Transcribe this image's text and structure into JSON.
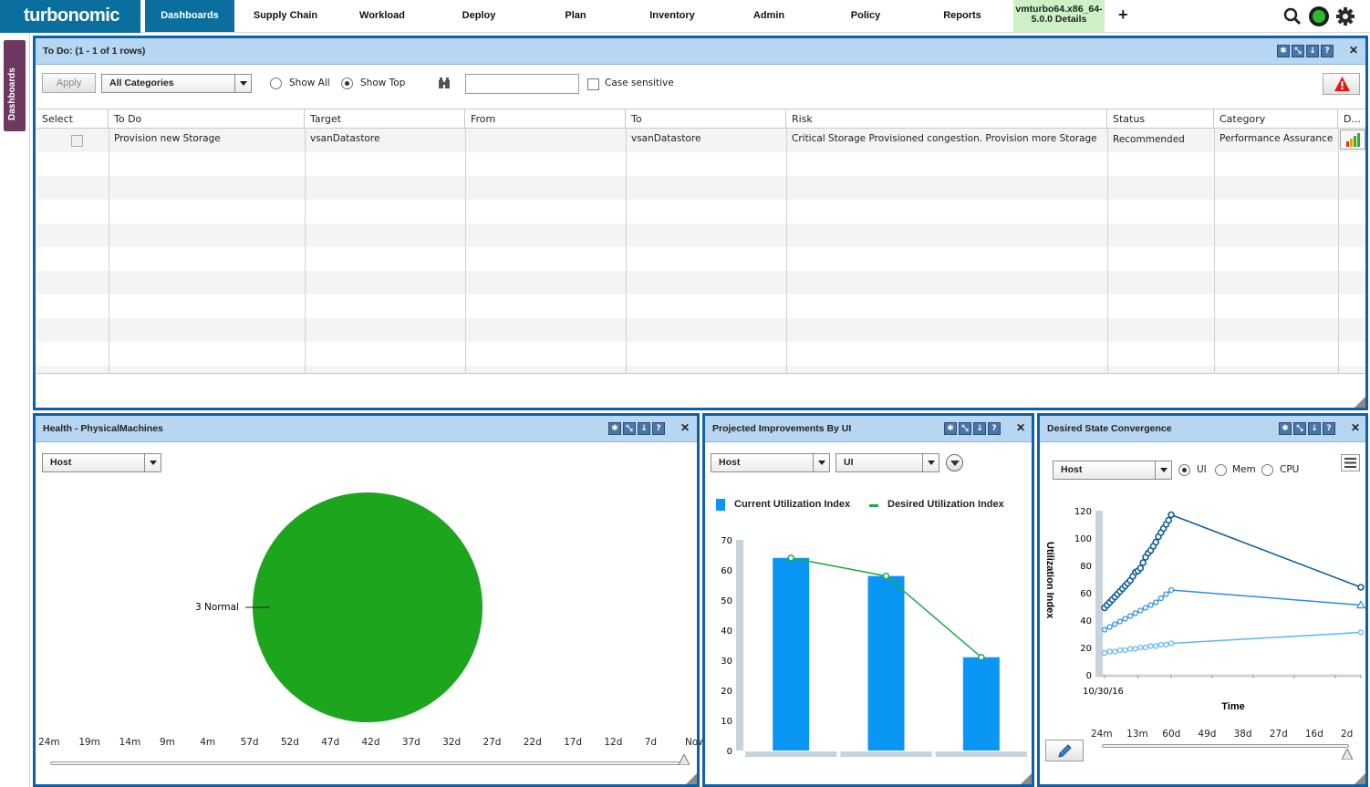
{
  "nav": {
    "logo": "turbonomic",
    "items": [
      {
        "label": "Dashboards",
        "active": true
      },
      {
        "label": "Supply Chain"
      },
      {
        "label": "Workload"
      },
      {
        "label": "Deploy"
      },
      {
        "label": "Plan"
      },
      {
        "label": "Inventory"
      },
      {
        "label": "Admin"
      },
      {
        "label": "Policy"
      },
      {
        "label": "Reports"
      }
    ],
    "vm_tab_line1": "vmturbo64.x86_64-",
    "vm_tab_line2": "5.0.0 Details",
    "add_label": "+"
  },
  "sidebar": {
    "tab_label": "Dashboards"
  },
  "todo": {
    "title": "To Do:",
    "rows_info": "(1 - 1 of 1 rows)",
    "apply_label": "Apply",
    "category_select": "All Categories",
    "show_all_label": "Show All",
    "show_top_label": "Show Top",
    "filter_value": "",
    "case_sensitive_label": "Case sensitive",
    "columns": [
      "Select",
      "To Do",
      "Target",
      "From",
      "To",
      "Risk",
      "Status",
      "Category",
      "D..."
    ],
    "row": {
      "todo": "Provision new Storage",
      "target": "vsanDatastore",
      "from": "",
      "to": "vsanDatastore",
      "risk": "Critical Storage Provisioned congestion. Provision more Storage",
      "status": "Recommended",
      "category": "Performance Assurance"
    }
  },
  "health": {
    "title": "Health - PhysicalMachines",
    "select": "Host",
    "slice_label": "3 Normal",
    "slice_color": "#1ea51e",
    "timeline": [
      "24m",
      "19m",
      "14m",
      "9m",
      "4m",
      "57d",
      "52d",
      "47d",
      "42d",
      "37d",
      "32d",
      "27d",
      "22d",
      "17d",
      "12d",
      "7d",
      "Now"
    ]
  },
  "projected": {
    "title": "Projected Improvements By UI",
    "select1": "Host",
    "select2": "UI",
    "legend_current": "Current Utilization Index",
    "legend_desired": "Desired Utilization Index",
    "current_color": "#0a96f5",
    "desired_color": "#1faa4a"
  },
  "desired": {
    "title": "Desired State Convergence",
    "select": "Host",
    "radio_ui": "UI",
    "radio_mem": "Mem",
    "radio_cpu": "CPU",
    "ylabel": "Utilization Index",
    "xlabel": "Time",
    "date_label": "10/30/16",
    "timeline": [
      "24m",
      "13m",
      "60d",
      "49d",
      "38d",
      "27d",
      "16d",
      "2d"
    ]
  },
  "chart_data": [
    {
      "type": "pie",
      "title": "Health - PhysicalMachines",
      "slices": [
        {
          "label": "Normal",
          "value": 3,
          "color": "#1ea51e"
        }
      ]
    },
    {
      "type": "bar",
      "title": "Projected Improvements By UI",
      "ylim": [
        0,
        70
      ],
      "yticks": [
        0,
        10,
        20,
        30,
        40,
        50,
        60,
        70
      ],
      "categories": [
        "",
        "",
        ""
      ],
      "series": [
        {
          "name": "Current Utilization Index",
          "type": "bar",
          "values": [
            64,
            58,
            31
          ]
        },
        {
          "name": "Desired Utilization Index",
          "type": "line",
          "values": [
            64,
            58,
            31
          ]
        }
      ]
    },
    {
      "type": "line",
      "title": "Desired State Convergence",
      "xlabel": "Time",
      "ylabel": "Utilization Index",
      "ylim": [
        0,
        120
      ],
      "yticks": [
        0,
        20,
        40,
        60,
        80,
        100,
        120
      ],
      "series": [
        {
          "name": "UI",
          "color": "#0d5c96",
          "x": [
            0.0,
            0.01,
            0.02,
            0.03,
            0.04,
            0.05,
            0.06,
            0.07,
            0.08,
            0.09,
            0.1,
            0.11,
            0.12,
            0.13,
            0.14,
            0.15,
            0.16,
            0.17,
            0.18,
            0.19,
            0.2,
            0.21,
            0.22,
            0.23,
            0.24,
            0.25,
            0.26,
            1.0
          ],
          "y": [
            49,
            51,
            53,
            55,
            57,
            59,
            61,
            63,
            65,
            67,
            69,
            72,
            75,
            76,
            78,
            82,
            86,
            89,
            91,
            94,
            97,
            101,
            104,
            107,
            110,
            113,
            117,
            64
          ]
        },
        {
          "name": "Mem",
          "color": "#2a8ee0",
          "x": [
            0.0,
            0.02,
            0.04,
            0.06,
            0.08,
            0.1,
            0.12,
            0.14,
            0.16,
            0.18,
            0.2,
            0.22,
            0.24,
            0.26,
            1.0
          ],
          "y": [
            33,
            35,
            37,
            39,
            41,
            43,
            45,
            47,
            49,
            51,
            53,
            56,
            59,
            62,
            51
          ]
        },
        {
          "name": "CPU",
          "color": "#5fb6f2",
          "x": [
            0.0,
            0.02,
            0.04,
            0.06,
            0.08,
            0.1,
            0.12,
            0.14,
            0.16,
            0.18,
            0.2,
            0.22,
            0.24,
            0.26,
            1.0
          ],
          "y": [
            16,
            17,
            17,
            18,
            18,
            19,
            19,
            20,
            20,
            21,
            21,
            22,
            22,
            23,
            31
          ]
        }
      ]
    }
  ]
}
